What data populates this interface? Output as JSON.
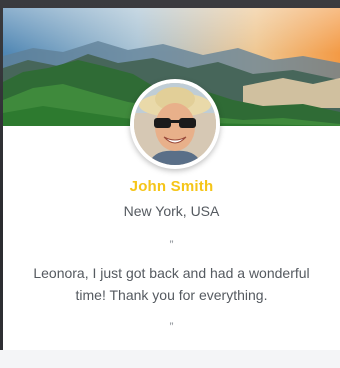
{
  "profile": {
    "name": "John Smith",
    "location": "New York, USA",
    "avatar_icon": "person-portrait-with-sunglasses"
  },
  "testimonial": {
    "open_quote": "”",
    "text": "Leonora, I just got back and had a wonderful time! Thank you for everything.",
    "close_quote": "”"
  },
  "banner": {
    "image": "mountain-landscape-sunset"
  },
  "colors": {
    "name_accent": "#f5c518",
    "text": "#555a60",
    "card_background": "#ffffff"
  }
}
